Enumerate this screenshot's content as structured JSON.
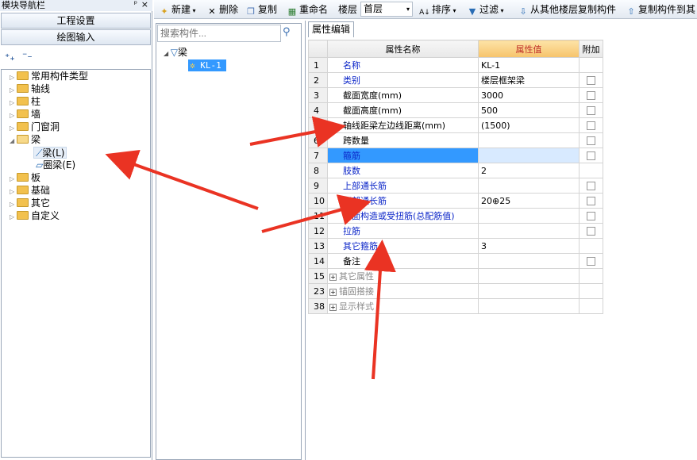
{
  "nav_panel": {
    "title": "模块导航栏",
    "pin_icon": "pin-icon",
    "close_label": "×",
    "sections": [
      "工程设置",
      "绘图输入"
    ],
    "tree": [
      {
        "label": "常用构件类型"
      },
      {
        "label": "轴线"
      },
      {
        "label": "柱"
      },
      {
        "label": "墙"
      },
      {
        "label": "门窗洞"
      },
      {
        "label": "梁",
        "children": [
          {
            "label": "梁(L)"
          },
          {
            "label": "圈梁(E)"
          }
        ]
      },
      {
        "label": "板"
      },
      {
        "label": "基础"
      },
      {
        "label": "其它"
      },
      {
        "label": "自定义"
      }
    ]
  },
  "toolbar": {
    "new_label": "新建",
    "delete_label": "删除",
    "copy_label": "复制",
    "rename_label": "重命名",
    "floor_label": "楼层",
    "floor_value": "首层",
    "sort_label": "排序",
    "filter_label": "过滤",
    "copy_from_floor_label": "从其他楼层复制构件",
    "copy_to_label": "复制构件到其"
  },
  "component_panel": {
    "search_placeholder": "搜索构件...",
    "root_label": "梁",
    "item_label": "KL-1"
  },
  "property_editor": {
    "tab_label": "属性编辑",
    "headers": {
      "index": "",
      "name": "属性名称",
      "value": "属性值",
      "attach": "附加"
    },
    "rows": [
      {
        "num": "1",
        "name": "名称",
        "value": "KL-1",
        "blue": true,
        "check": false
      },
      {
        "num": "2",
        "name": "类别",
        "value": "楼层框架梁",
        "blue": true,
        "check": true
      },
      {
        "num": "3",
        "name": "截面宽度(mm)",
        "value": "3000",
        "blue": false,
        "check": true
      },
      {
        "num": "4",
        "name": "截面高度(mm)",
        "value": "500",
        "blue": false,
        "check": true
      },
      {
        "num": "5",
        "name": "轴线距梁左边线距离(mm)",
        "value": "(1500)",
        "blue": false,
        "check": true
      },
      {
        "num": "6",
        "name": "跨数量",
        "value": "",
        "blue": false,
        "check": true
      },
      {
        "num": "7",
        "name": "箍筋",
        "value": "",
        "blue": true,
        "check": true,
        "selected": true
      },
      {
        "num": "8",
        "name": "肢数",
        "value": "2",
        "blue": true,
        "check": false
      },
      {
        "num": "9",
        "name": "上部通长筋",
        "value": "",
        "blue": true,
        "check": true
      },
      {
        "num": "10",
        "name": "下部通长筋",
        "value": "20⊕25",
        "blue": true,
        "check": true
      },
      {
        "num": "11",
        "name": "侧面构造或受扭筋(总配筋值)",
        "value": "",
        "blue": true,
        "check": true
      },
      {
        "num": "12",
        "name": "拉筋",
        "value": "",
        "blue": true,
        "check": true
      },
      {
        "num": "13",
        "name": "其它箍筋",
        "value": "3",
        "blue": true,
        "check": false
      },
      {
        "num": "14",
        "name": "备注",
        "value": "",
        "blue": false,
        "check": true
      },
      {
        "num": "15",
        "name": "其它属性",
        "value": "",
        "group": true
      },
      {
        "num": "23",
        "name": "锚固搭接",
        "value": "",
        "group": true
      },
      {
        "num": "38",
        "name": "显示样式",
        "value": "",
        "group": true
      }
    ]
  },
  "colors": {
    "arrow": "#ea3323",
    "selected_row": "#3399ff",
    "header_value": "#f6c36b"
  }
}
